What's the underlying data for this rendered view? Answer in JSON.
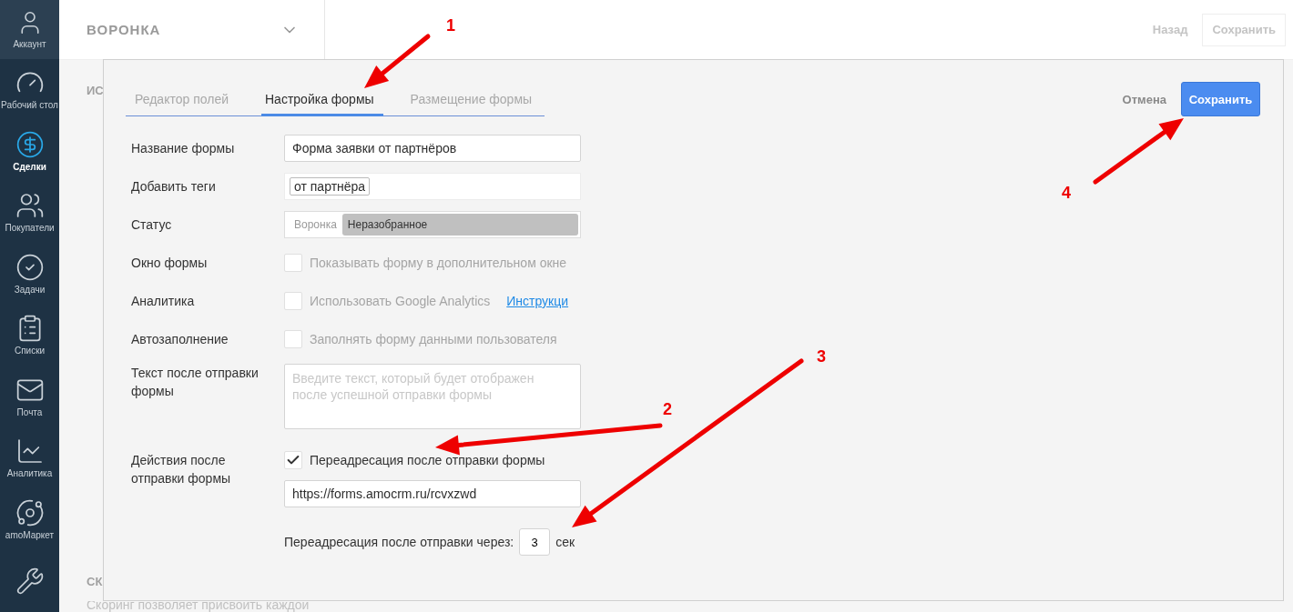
{
  "sidebar": {
    "items": [
      {
        "kind": "account",
        "label": "Аккаунт",
        "selected": false
      },
      {
        "kind": "dashboard",
        "label": "Рабочий стол",
        "selected": false
      },
      {
        "kind": "deals",
        "label": "Сделки",
        "selected": true
      },
      {
        "kind": "customers",
        "label": "Покупатели",
        "selected": false
      },
      {
        "kind": "tasks",
        "label": "Задачи",
        "selected": false
      },
      {
        "kind": "lists",
        "label": "Списки",
        "selected": false
      },
      {
        "kind": "mail",
        "label": "Почта",
        "selected": false
      },
      {
        "kind": "analytics",
        "label": "Аналитика",
        "selected": false
      },
      {
        "kind": "market",
        "label": "amoМаркет",
        "selected": false
      },
      {
        "kind": "settings"
      }
    ]
  },
  "header": {
    "title": "ВОРОНКА",
    "back": "Назад",
    "save": "Сохранить"
  },
  "background": {
    "heading_1": "ИС",
    "heading_2": "СК",
    "description": "Скоринг позволяет присвоить каждой"
  },
  "modal": {
    "tabs": [
      {
        "label": "Редактор полей",
        "selected": false
      },
      {
        "label": "Настройка формы",
        "selected": true
      },
      {
        "label": "Размещение формы",
        "selected": false
      }
    ],
    "cancel": "Отмена",
    "save": "Сохранить",
    "fields": [
      {
        "kind": "text",
        "label": "Название формы",
        "value": "Форма заявки от партнёров"
      },
      {
        "kind": "tags",
        "label": "Добавить теги",
        "tags": [
          "от партнёра"
        ]
      },
      {
        "kind": "status",
        "label": "Статус",
        "pipeline": "Воронка",
        "stage": "Неразобранное"
      },
      {
        "kind": "checkbox",
        "label": "Окно формы",
        "option": "Показывать форму в дополнительном окне",
        "checked": false
      },
      {
        "kind": "checkbox",
        "label": "Аналитика",
        "option": "Использовать Google Analytics",
        "checked": false,
        "link": "Инструкци"
      },
      {
        "kind": "checkbox",
        "label": "Автозаполнение",
        "option": "Заполнять форму данными пользователя",
        "checked": false
      },
      {
        "kind": "textarea",
        "label": "Текст после отправки формы",
        "placeholder": "Введите текст, который будет отображен после успешной отправки формы"
      },
      {
        "kind": "redirect",
        "label": "Действия после отправки формы",
        "option": "Переадресация после отправки формы",
        "checked": true,
        "url": "https://forms.amocrm.ru/rcvxzwd",
        "delay_label": "Переадресация после отправки через:",
        "delay": "3",
        "unit": "сек"
      }
    ]
  },
  "annotations": [
    {
      "number": "1"
    },
    {
      "number": "2"
    },
    {
      "number": "3"
    },
    {
      "number": "4"
    }
  ]
}
